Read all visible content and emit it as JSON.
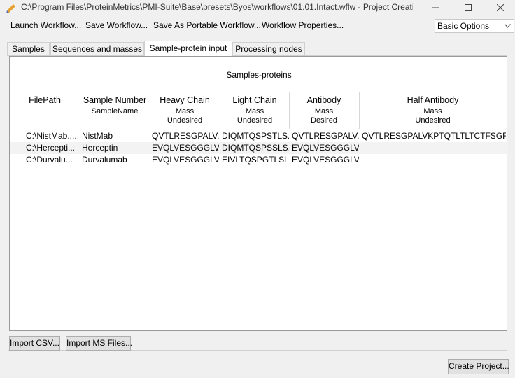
{
  "window": {
    "title": "C:\\Program Files\\ProteinMetrics\\PMI-Suite\\Base\\presets\\Byos\\workflows\\01.01.Intact.wflw - Project Creati...",
    "minimize_icon": "minimize-icon",
    "maximize_icon": "maximize-icon",
    "close_icon": "close-icon"
  },
  "toolbar": {
    "launch": "Launch Workflow...",
    "save": "Save Workflow...",
    "save_portable": "Save As Portable Workflow...",
    "properties": "Workflow Properties...",
    "options_selected": "Basic Options"
  },
  "tabs": [
    {
      "label": "Samples"
    },
    {
      "label": "Sequences and masses"
    },
    {
      "label": "Sample-protein input"
    },
    {
      "label": "Processing nodes"
    }
  ],
  "table": {
    "title": "Samples-proteins",
    "columns": [
      {
        "header": "FilePath",
        "sub1": "",
        "sub2": ""
      },
      {
        "header": "Sample Number",
        "sub1": "SampleName",
        "sub2": ""
      },
      {
        "header": "Heavy Chain",
        "sub1": "Mass",
        "sub2": "Undesired"
      },
      {
        "header": "Light Chain",
        "sub1": "Mass",
        "sub2": "Undesired"
      },
      {
        "header": "Antibody",
        "sub1": "Mass",
        "sub2": "Desired"
      },
      {
        "header": "Half Antibody",
        "sub1": "Mass",
        "sub2": "Undesired"
      }
    ],
    "rows": [
      [
        "C:\\NistMab....",
        "NistMab",
        "QVTLRESGPALV...",
        "DIQMTQSPSTLS...",
        "QVTLRESGPALV...",
        "QVTLRESGPALVKPTQTLTLTCTFSGFSLS..."
      ],
      [
        "C:\\Hercepti...",
        "Herceptin",
        "EVQLVESGGGLV...",
        "DIQMTQSPSSLS...",
        "EVQLVESGGGLV...",
        ""
      ],
      [
        "C:\\Durvalu...",
        "Durvalumab",
        "EVQLVESGGGLV...",
        "EIVLTQSPGTLSL...",
        "EVQLVESGGGLV...",
        ""
      ]
    ]
  },
  "buttons": {
    "import_csv": "Import CSV...",
    "import_ms": "Import MS Files...",
    "create_project": "Create Project..."
  }
}
